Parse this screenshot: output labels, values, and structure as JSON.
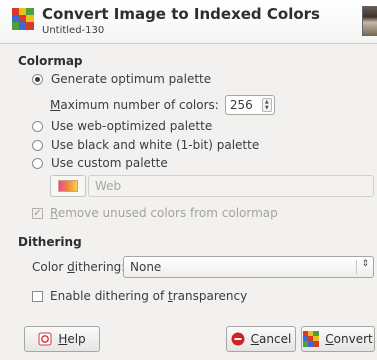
{
  "header": {
    "title": "Convert Image to Indexed Colors",
    "subtitle": "Untitled-130"
  },
  "colormap": {
    "section_title": "Colormap",
    "options": [
      {
        "label": "Generate optimum palette",
        "checked": true
      },
      {
        "label": "Use web-optimized palette",
        "checked": false
      },
      {
        "label": "Use black and white (1-bit) palette",
        "checked": false
      },
      {
        "label": "Use custom palette",
        "checked": false
      }
    ],
    "max_colors": {
      "label_prefix": "",
      "label_mnemonic": "M",
      "label_rest": "aximum number of colors:",
      "value": "256"
    },
    "custom_palette_name": "Web",
    "remove_unused": {
      "mnemonic": "R",
      "rest": "emove unused colors from colormap",
      "checked": true,
      "enabled": false
    }
  },
  "dithering": {
    "section_title": "Dithering",
    "color_dithering_label_a": "Color ",
    "color_dithering_label_mnemonic": "d",
    "color_dithering_label_b": "ithering:",
    "color_dithering_value": "None",
    "transparency": {
      "label_a": "Enable dithering of ",
      "label_mnemonic": "t",
      "label_b": "ransparency",
      "checked": false
    }
  },
  "buttons": {
    "help_mnemonic": "H",
    "help_rest": "elp",
    "cancel_mnemonic": "C",
    "cancel_rest": "ancel",
    "convert_mnemonic": "C",
    "convert_rest": "onvert"
  },
  "icons": {
    "header": "indexed-grid-icon",
    "help": "help-icon",
    "cancel": "cancel-icon",
    "convert": "indexed-grid-icon",
    "palette": "palette-icon"
  },
  "colors": {
    "cancel_red": "#d42020",
    "grid_red": "#d73a2a",
    "grid_green": "#4aa03a",
    "grid_blue": "#3a6ad0",
    "grid_yellow": "#e8c020"
  }
}
